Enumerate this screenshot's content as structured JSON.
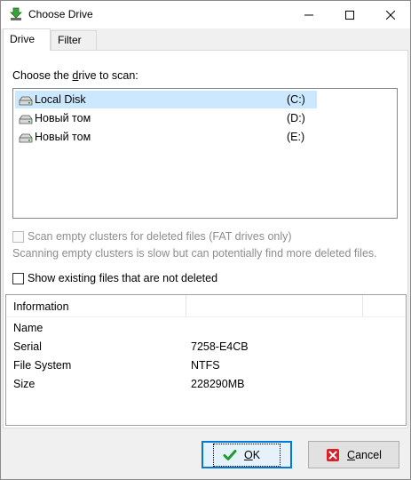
{
  "window": {
    "title": "Choose Drive",
    "controls": [
      "minimize",
      "maximize",
      "close"
    ]
  },
  "tabs": [
    {
      "label": "Drive",
      "active": true
    },
    {
      "label": "Filter",
      "active": false
    }
  ],
  "drive_panel": {
    "choose_label_pre": "Choose the ",
    "choose_label_accel": "d",
    "choose_label_post": "rive to scan:",
    "drives": [
      {
        "name": "Local Disk",
        "letter": "(C:)",
        "selected": true
      },
      {
        "name": "Новый том",
        "letter": "(D:)",
        "selected": false
      },
      {
        "name": "Новый том",
        "letter": "(E:)",
        "selected": false
      }
    ],
    "scan_empty": {
      "label": "Scan empty clusters for deleted files (FAT drives only)",
      "checked": false,
      "enabled": false
    },
    "scan_hint": "Scanning empty clusters is slow but can potentially find more deleted files.",
    "show_existing": {
      "label": "Show existing files that are not deleted",
      "checked": false,
      "enabled": true
    }
  },
  "info": {
    "header": "Information",
    "rows": [
      {
        "key": "Name",
        "value": ""
      },
      {
        "key": "Serial",
        "value": "7258-E4CB"
      },
      {
        "key": "File System",
        "value": "NTFS"
      },
      {
        "key": "Size",
        "value": "228290MB"
      }
    ]
  },
  "buttons": {
    "ok_accel": "O",
    "ok_rest": "K",
    "cancel_accel": "C",
    "cancel_rest": "ancel"
  },
  "colors": {
    "selection": "#cce8ff",
    "focus_border": "#0078d7",
    "ok_icon": "#1f9b2a",
    "cancel_icon": "#d6202a"
  },
  "icons": {
    "title": "download-arrow-icon",
    "drive": "hard-drive-icon",
    "ok": "checkmark-icon",
    "cancel": "x-icon"
  }
}
